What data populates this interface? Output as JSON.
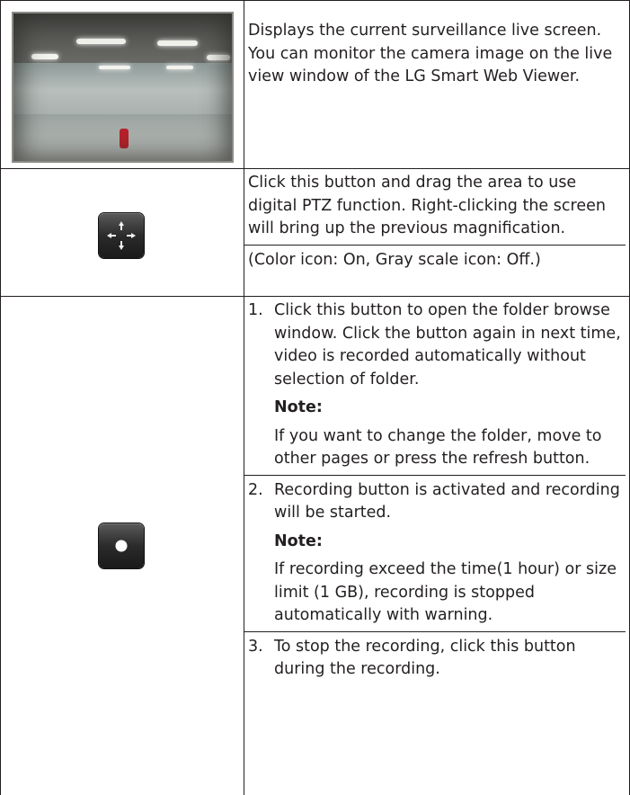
{
  "rows": [
    {
      "icon": "live-camera-preview",
      "text": "Displays the current surveillance live screen. You can monitor the camera image on the live view window of the LG Smart Web Viewer."
    },
    {
      "icon": "digital-ptz-icon",
      "text": "Click this button and drag the area to use digital PTZ function. Right-clicking the screen will bring up the previous magnification.",
      "sub": "(Color icon: On, Gray scale icon: Off.)"
    },
    {
      "icon": "record-icon",
      "items": [
        {
          "num": "1.",
          "text": "Click this button to open the folder browse window. Click the button again in next time, video is recorded automatically without selection of folder.",
          "note_label": "Note:",
          "note": "If you want to change the folder, move to other pages or press the refresh button."
        },
        {
          "num": "2.",
          "text": "Recording button is activated and recording will be started.",
          "note_label": "Note:",
          "note": "If recording exceed the time(1 hour) or size limit (1 GB), recording is stopped automatically with warning."
        },
        {
          "num": "3.",
          "text": "To stop the recording, click this button during the recording."
        }
      ]
    }
  ]
}
